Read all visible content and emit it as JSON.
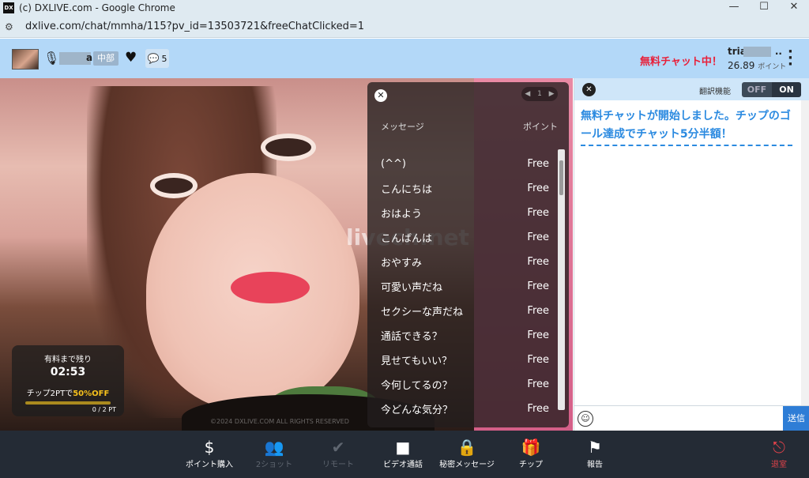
{
  "window": {
    "favicon": "DX",
    "title": "(c) DXLIVE.com - Google Chrome",
    "minimize_icon": "minimize-icon",
    "maximize_icon": "maximize-icon",
    "close_icon": "close-icon",
    "minimize_glyph": "—",
    "maximize_glyph": "☐",
    "close_glyph": "✕"
  },
  "address": {
    "url": "dxlive.com/chat/mmha/115?pv_id=13503721&freeChatClicked=1",
    "tune_glyph": "⚙"
  },
  "topbar": {
    "username_suffix": "a",
    "region": "中部",
    "message_count": "5",
    "free_chat_status": "無料チャット中！",
    "user_prefix": "tria",
    "user_suffix": "..",
    "points_value": "26.89",
    "points_unit": "ポイント"
  },
  "timer": {
    "label": "有料まで残り",
    "time": "02:53",
    "chip_prefix": "チップ2PTで",
    "chip_highlight": "50%OFF",
    "progress_fraction": 0.0,
    "progress_text": "0 / 2 PT"
  },
  "copyright": "©2024 DXLIVE.COM ALL RIGHTS RESERVED",
  "watermark": "livech.net",
  "message_panel": {
    "close_glyph": "✕",
    "pager_prev": "◀",
    "pager_page": "1",
    "pager_next": "▶",
    "col_message": "メッセージ",
    "col_points": "ポイント",
    "items": [
      {
        "text": "(^^)",
        "cost": "Free"
      },
      {
        "text": "こんにちは",
        "cost": "Free"
      },
      {
        "text": "おはよう",
        "cost": "Free"
      },
      {
        "text": "こんばんは",
        "cost": "Free"
      },
      {
        "text": "おやすみ",
        "cost": "Free"
      },
      {
        "text": "可愛い声だね",
        "cost": "Free"
      },
      {
        "text": "セクシーな声だね",
        "cost": "Free"
      },
      {
        "text": "通話できる？",
        "cost": "Free"
      },
      {
        "text": "見せてもいい？",
        "cost": "Free"
      },
      {
        "text": "今何してるの？",
        "cost": "Free"
      },
      {
        "text": "今どんな気分？",
        "cost": "Free"
      }
    ]
  },
  "chat": {
    "close_glyph": "✕",
    "translate_label": "翻訳機能",
    "toggle_off": "OFF",
    "toggle_on": "ON",
    "system_message": "無料チャットが開始しました。チップのゴール達成でチャット5分半額！",
    "emoji_glyph": "☺",
    "send_label": "送信"
  },
  "bottom_buttons": [
    {
      "icon": "$",
      "label": "ポイント購入",
      "state": "enabled"
    },
    {
      "icon": "👥",
      "label": "2ショット",
      "state": "disabled"
    },
    {
      "icon": "✔",
      "label": "リモート",
      "state": "disabled"
    },
    {
      "icon": "■",
      "label": "ビデオ通話",
      "state": "enabled"
    },
    {
      "icon": "🔒",
      "label": "秘密メッセージ",
      "state": "enabled"
    },
    {
      "icon": "🎁",
      "label": "チップ",
      "state": "enabled"
    },
    {
      "icon": "⚑",
      "label": "報告",
      "state": "enabled"
    },
    {
      "icon": "⎋",
      "label": "退室",
      "state": "exit"
    }
  ],
  "colors": {
    "topbar_bg": "#b3d8f8",
    "free_chat_red": "#e8203a",
    "chat_message_blue": "#2b8ae0",
    "bottombar_bg": "#242b35",
    "exit_red": "#e0424a",
    "send_blue": "#2e7dd6"
  }
}
